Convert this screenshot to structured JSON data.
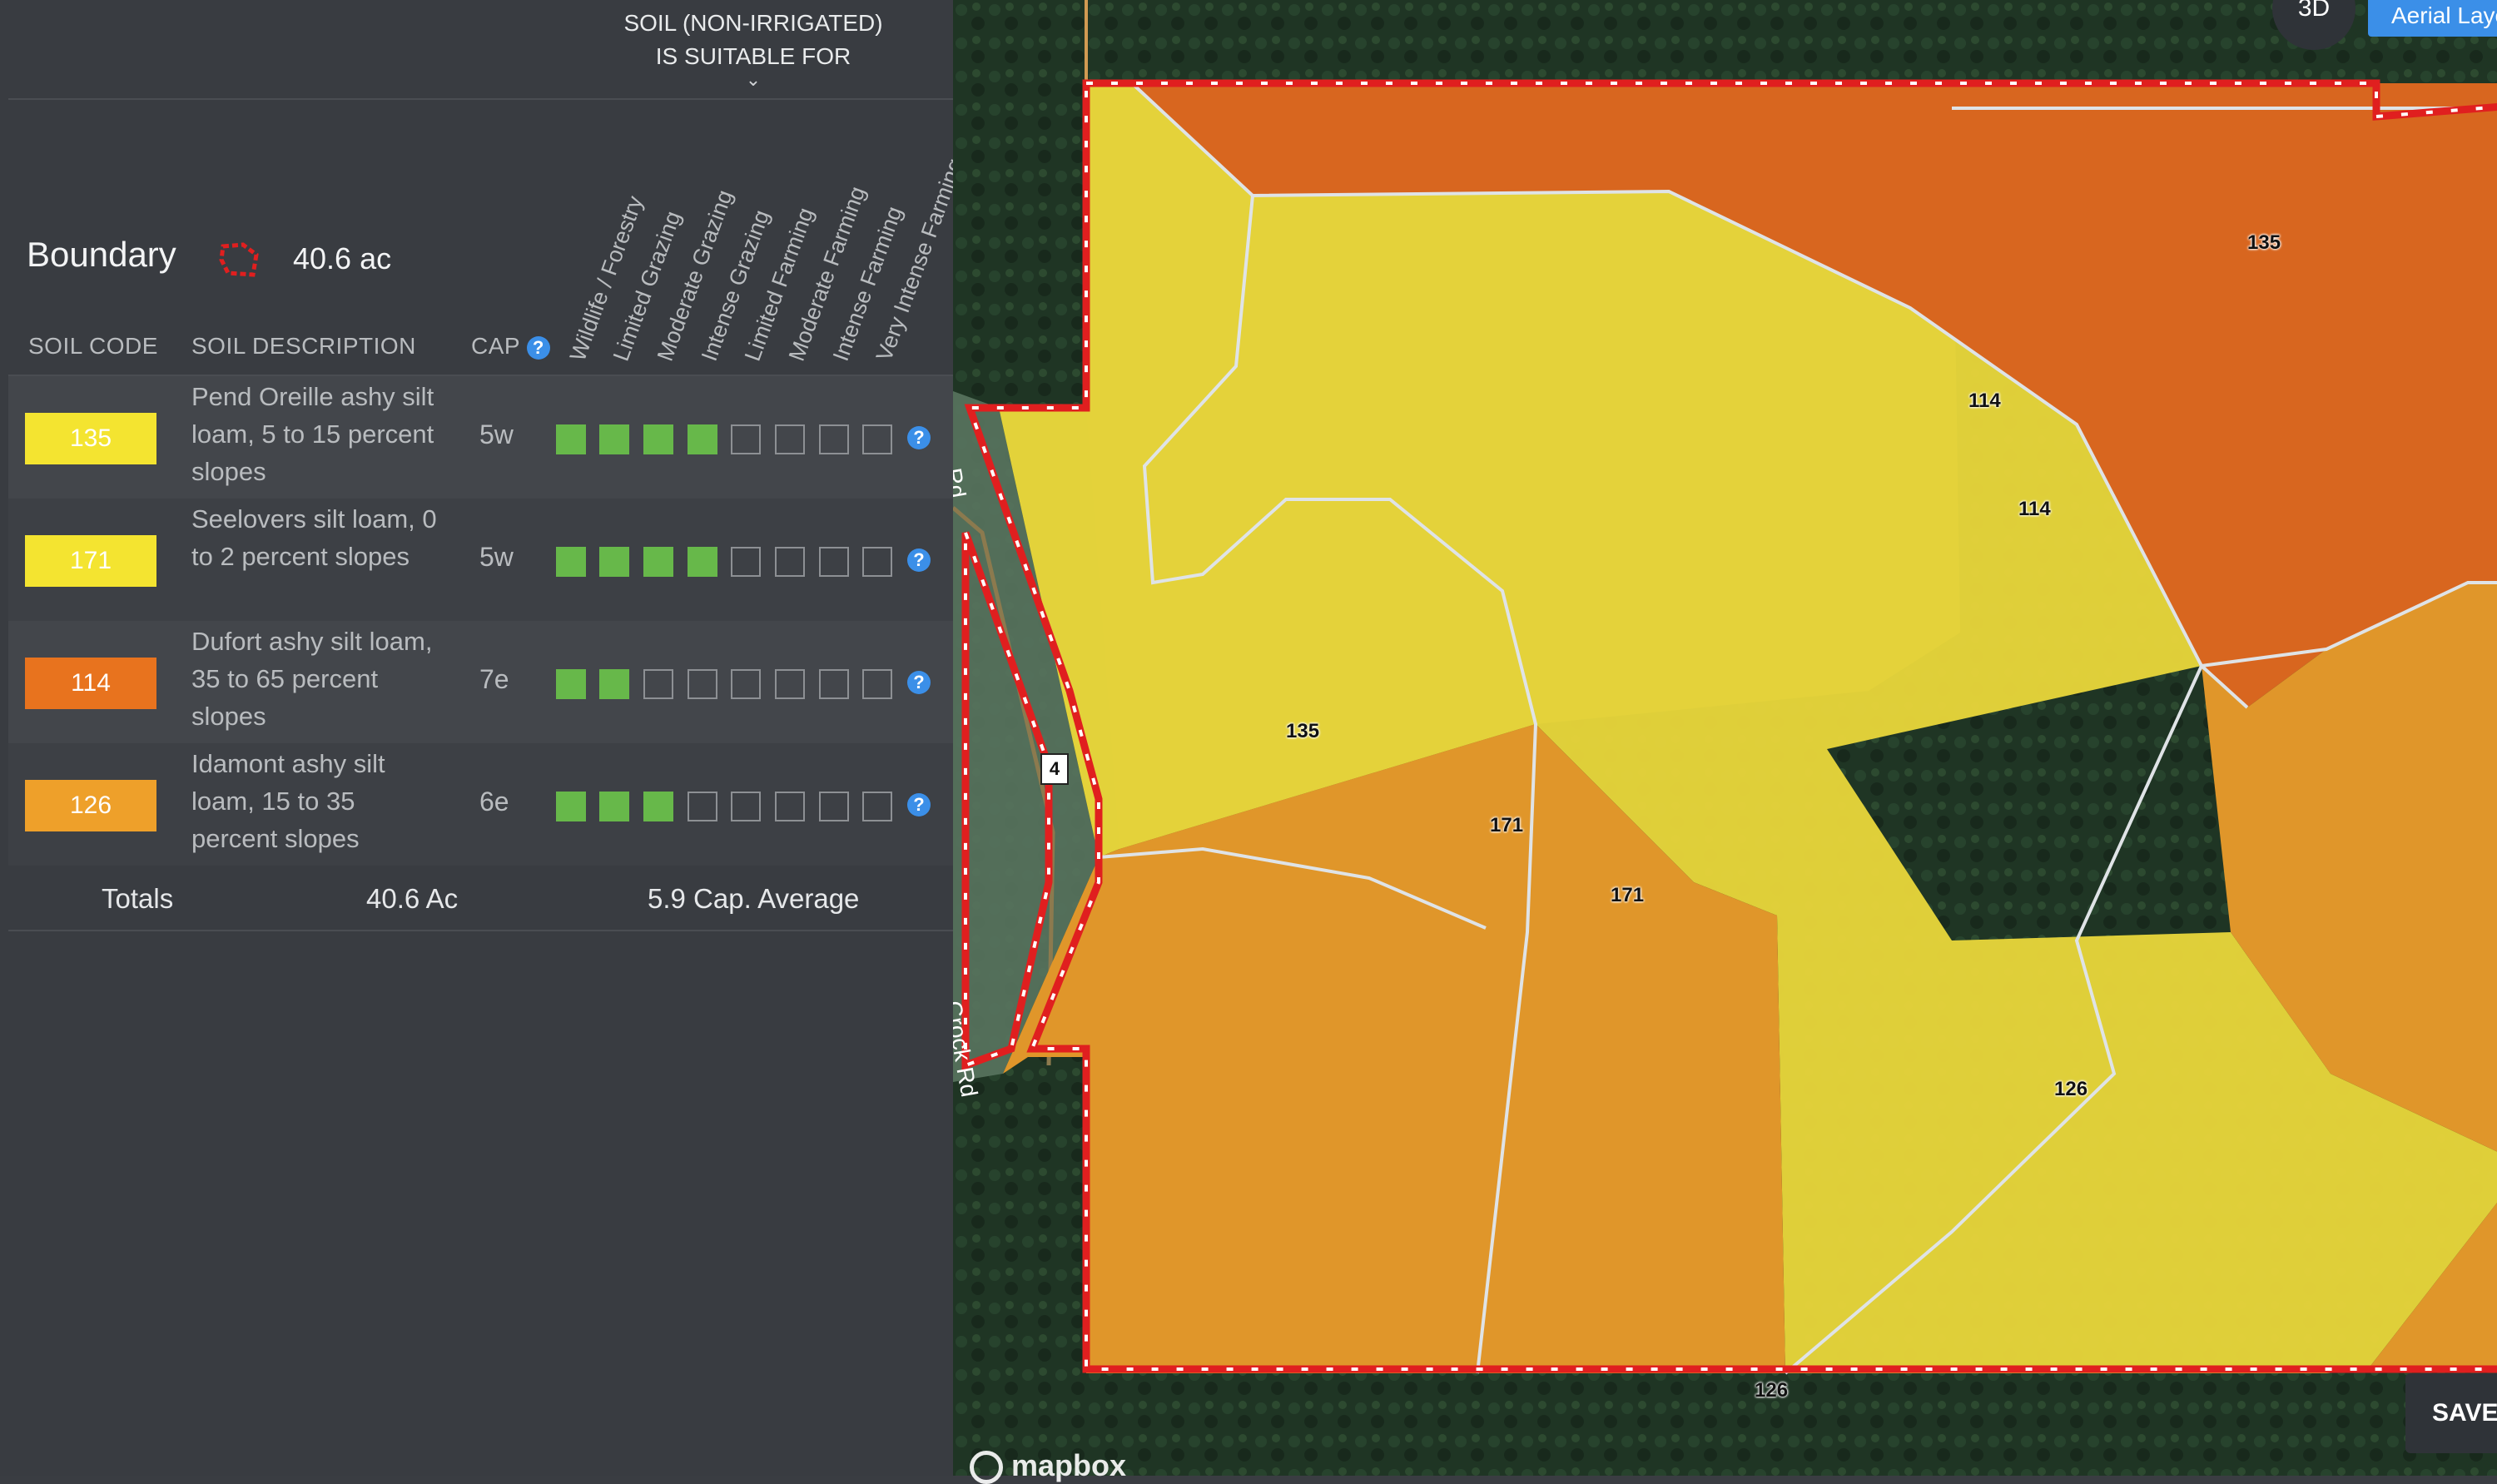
{
  "header": {
    "suitable_line1": "SOIL (NON-IRRIGATED)",
    "suitable_line2": "IS SUITABLE FOR",
    "chevron": "⌄"
  },
  "boundary": {
    "label": "Boundary",
    "area": "40.6 ac",
    "icon": "boundary-polygon-icon"
  },
  "suitability_columns": [
    "Wildlife / Forestry",
    "Limited Grazing",
    "Moderate Grazing",
    "Intense Grazing",
    "Limited Farming",
    "Moderate Farming",
    "Intense Farming",
    "Very Intense Farming"
  ],
  "columns": {
    "soil_code": "SOIL CODE",
    "soil_description": "SOIL DESCRIPTION",
    "cap": "CAP"
  },
  "soils": [
    {
      "code": "135",
      "color": "#f4e430",
      "description": "Pend Oreille ashy silt loam, 5 to 15 percent slopes",
      "cap": "5w",
      "suitable": [
        true,
        true,
        true,
        true,
        false,
        false,
        false,
        false
      ]
    },
    {
      "code": "171",
      "color": "#f4e430",
      "description": "Seelovers silt loam, 0 to 2 percent slopes",
      "cap": "5w",
      "suitable": [
        true,
        true,
        true,
        true,
        false,
        false,
        false,
        false
      ]
    },
    {
      "code": "114",
      "color": "#e8731e",
      "description": "Dufort ashy silt loam, 35 to 65 percent slopes",
      "cap": "7e",
      "suitable": [
        true,
        true,
        false,
        false,
        false,
        false,
        false,
        false
      ]
    },
    {
      "code": "126",
      "color": "#eea02a",
      "description": "Idamont ashy silt loam, 15 to 35 percent slopes",
      "cap": "6e",
      "suitable": [
        true,
        true,
        true,
        false,
        false,
        false,
        false,
        false
      ]
    }
  ],
  "totals": {
    "label": "Totals",
    "area": "40.6 Ac",
    "cap_average": "5.9 Cap. Average"
  },
  "map": {
    "btn_3d": "3D",
    "btn_layers": "Aerial Layers",
    "btn_save": "SAVE",
    "attribution": "mapbox",
    "labels": [
      "135",
      "114",
      "114",
      "135",
      "171",
      "171",
      "126",
      "126"
    ],
    "road_labels": [
      "Rd",
      "Crock Rd"
    ],
    "shield": "4",
    "zone_colors": {
      "yellow": "#e3d23a",
      "orange_red": "#d8661f",
      "orange": "#e0962a",
      "boundary": "#e01f1f"
    }
  }
}
